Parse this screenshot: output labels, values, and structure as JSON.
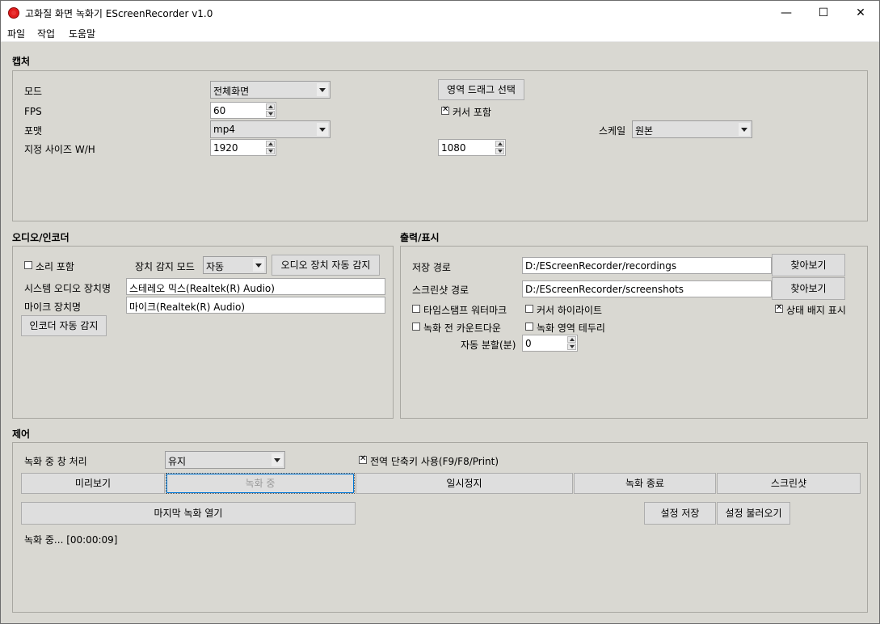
{
  "window": {
    "title": "고화질 화면 녹화기 EScreenRecorder v1.0",
    "minimize": "—",
    "maximize": "☐",
    "close": "✕"
  },
  "menu": [
    "파일",
    "작업",
    "도움말"
  ],
  "capture": {
    "title": "캡처",
    "mode_label": "모드",
    "mode_value": "전체화면",
    "drag_button": "영역 드래그 선택",
    "fps_label": "FPS",
    "fps_value": "60",
    "cursor_label": "커서 포함",
    "cursor_checked": true,
    "format_label": "포맷",
    "format_value": "mp4",
    "scale_label": "스케일",
    "scale_value": "원본",
    "size_label": "지정 사이즈 W/H",
    "width_value": "1920",
    "height_value": "1080"
  },
  "audio": {
    "title": "오디오/인코더",
    "sound_label": "소리 포함",
    "sound_checked": false,
    "detect_mode_label": "장치 감지 모드",
    "detect_mode_value": "자동",
    "auto_detect_button": "오디오 장치 자동 감지",
    "system_device_label": "시스템 오디오 장치명",
    "system_device_value": "스테레오 믹스(Realtek(R) Audio)",
    "mic_label": "마이크 장치명",
    "mic_value": "마이크(Realtek(R) Audio)",
    "encoder_detect_button": "인코더 자동 감지"
  },
  "output": {
    "title": "출력/표시",
    "save_path_label": "저장 경로",
    "save_path_value": "D:/EScreenRecorder/recordings",
    "screenshot_path_label": "스크린샷 경로",
    "screenshot_path_value": "D:/EScreenRecorder/screenshots",
    "browse_label": "찾아보기",
    "timestamp_label": "타임스탬프 워터마크",
    "cursor_highlight_label": "커서 하이라이트",
    "status_badge_label": "상태 배지 표시",
    "countdown_label": "녹화 전 카운트다운",
    "region_border_label": "녹화 영역 테두리",
    "split_label": "자동 분할(분)",
    "split_value": "0"
  },
  "control": {
    "title": "제어",
    "window_handling_label": "녹화 중 창 처리",
    "window_handling_value": "유지",
    "hotkey_label": "전역 단축키 사용(F9/F8/Print)",
    "hotkey_checked": true,
    "preview_button": "미리보기",
    "recording_button": "녹화 중",
    "pause_button": "일시정지",
    "stop_button": "녹화 종료",
    "screenshot_button": "스크린샷",
    "open_last_button": "마지막 녹화 열기",
    "save_settings_button": "설정 저장",
    "load_settings_button": "설정 불러오기",
    "status_text": "녹화 중... [00:00:09]"
  }
}
